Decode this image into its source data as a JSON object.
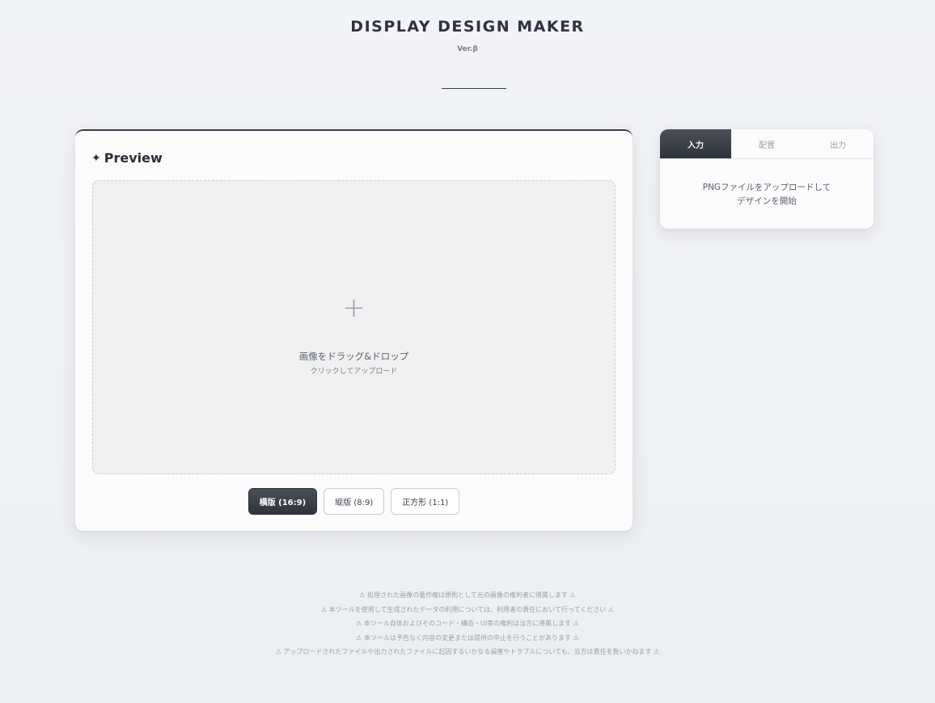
{
  "header": {
    "title": "DISPLAY DESIGN MAKER",
    "version": "Ver.β"
  },
  "preview": {
    "heading_icon": "✦",
    "heading": "Preview",
    "dropzone": {
      "plus_icon": "+",
      "main_text": "画像をドラッグ&ドロップ",
      "sub_text": "クリックしてアップロード"
    },
    "ratio_buttons": [
      {
        "label": "横版 (16:9)",
        "active": true
      },
      {
        "label": "縦版 (8:9)",
        "active": false
      },
      {
        "label": "正方形 (1:1)",
        "active": false
      }
    ]
  },
  "side_panel": {
    "tabs": [
      {
        "label": "入力",
        "active": true
      },
      {
        "label": "配置",
        "active": false
      },
      {
        "label": "出力",
        "active": false
      }
    ],
    "message_line1": "PNGファイルをアップロードして",
    "message_line2": "デザインを開始"
  },
  "notices": [
    "⚠ 処理された画像の著作権は原則として元の画像の権利者に帰属します ⚠",
    "⚠ 本ツールを使用して生成されたデータの利用については、利用者の責任において行ってください ⚠",
    "⚠ 本ツール自体およびそのコード・構造・UI等の権利は当方に帰属します ⚠",
    "⚠ 本ツールは予告なく内容の変更または提供の中止を行うことがあります ⚠",
    "⚠ アップロードされたファイルや出力されたファイルに起因するいかなる損害やトラブルについても、当方は責任を負いかねます ⚠"
  ],
  "colors": {
    "accent_dark": "#2f343c",
    "background": "#f2f3f6"
  }
}
